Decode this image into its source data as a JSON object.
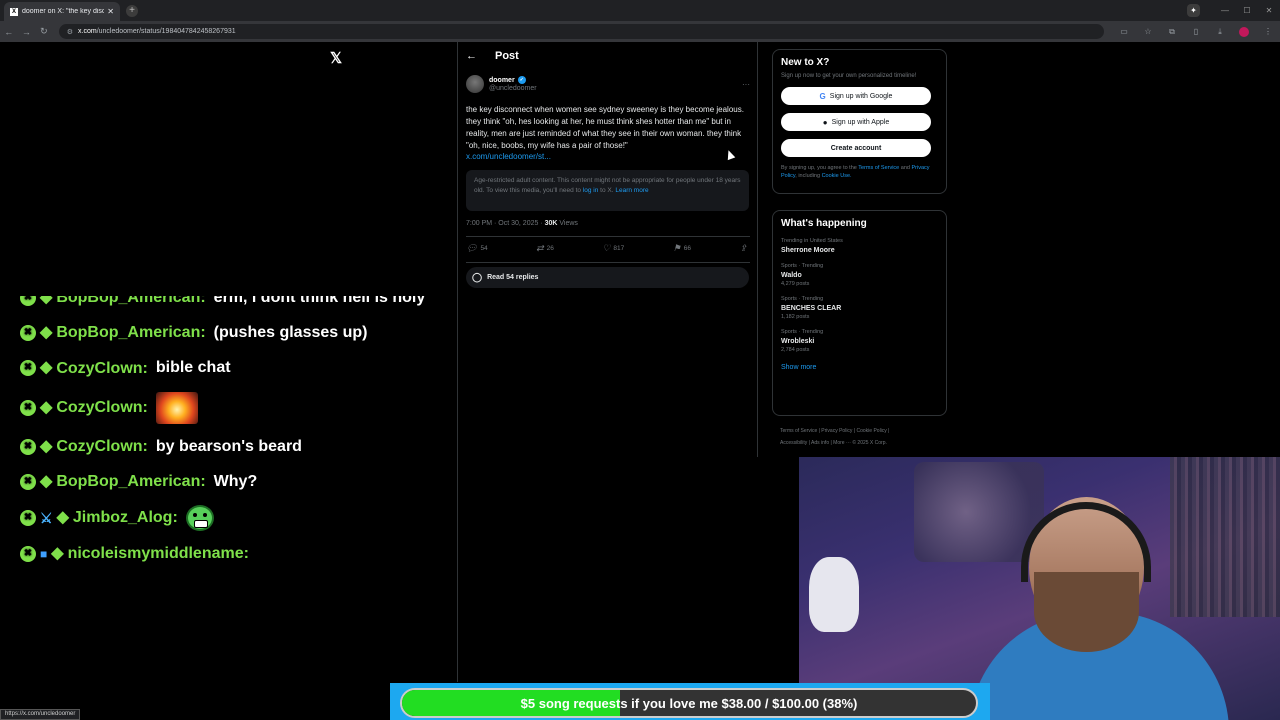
{
  "browser": {
    "tab_title": "doomer on X: \"the key disconnect",
    "url_host": "x.com",
    "url_path": "/uncledoomer/status/1984047842458267931",
    "status_url": "https://x.com/uncledoomer"
  },
  "post": {
    "header_title": "Post",
    "author_name": "doomer",
    "author_handle": "@uncledoomer",
    "text": "the key disconnect when women see sydney sweeney is they become jealous. they think \"oh, hes looking at her, he must think shes hotter than me\" but in reality, men are just reminded of what they see in their own woman. they think \"oh, nice, boobs, my wife has a pair of those!\"",
    "link": "x.com/uncledoomer/st...",
    "age_notice": "Age-restricted adult content. This content might not be appropriate for people under 18 years old. To view this media, you'll need to",
    "age_login": "log in",
    "age_mid": "to X.",
    "age_learn": "Learn more",
    "timestamp": "7:00 PM · Oct 30, 2025 · ",
    "views_count": "30K",
    "views_label": " Views",
    "replies": "54",
    "reposts": "26",
    "likes": "817",
    "bookmarks": "66",
    "read_replies": "Read 54 replies"
  },
  "signup": {
    "title": "New to X?",
    "subtitle": "Sign up now to get your own personalized timeline!",
    "google": "Sign up with Google",
    "apple": "Sign up with Apple",
    "create": "Create account",
    "legal_pre": "By signing up, you agree to the",
    "terms": "Terms of Service",
    "and": "and",
    "privacy": "Privacy Policy",
    "including": ", including",
    "cookie": "Cookie Use."
  },
  "happening": {
    "title": "What's happening",
    "trends": [
      {
        "context": "Trending in United States",
        "name": "Sherrone Moore",
        "count": ""
      },
      {
        "context": "Sports · Trending",
        "name": "Waldo",
        "count": "4,279 posts"
      },
      {
        "context": "Sports · Trending",
        "name": "BENCHES CLEAR",
        "count": "1,182 posts"
      },
      {
        "context": "Sports · Trending",
        "name": "Wrobleski",
        "count": "2,784 posts"
      }
    ],
    "show_more": "Show more"
  },
  "footer": {
    "line1": "Terms of Service  |  Privacy Policy  |  Cookie Policy  |",
    "line2": "Accessibility  |  Ads info  |  More ···  © 2025 X Corp."
  },
  "chat": {
    "messages": [
      {
        "user": "BopBop_American:",
        "text": "erm, i dont think hell is holy"
      },
      {
        "user": "BopBop_American:",
        "text": "(pushes glasses up)"
      },
      {
        "user": "CozyClown:",
        "text": "bible chat"
      },
      {
        "user": "CozyClown:",
        "text": ""
      },
      {
        "user": "CozyClown:",
        "text": "by bearson's beard"
      },
      {
        "user": "BopBop_American:",
        "text": "Why?"
      },
      {
        "user": "Jimboz_Alog:",
        "text": ""
      },
      {
        "user": "nicoleismymiddlename:",
        "text": ""
      }
    ]
  },
  "donation": {
    "text": "$5 song requests if you love me $38.00 / $100.00 (38%)",
    "progress": 0.38,
    "fill_color": "#22dd22"
  },
  "colors": {
    "accent": "#1d9bf0",
    "chat_user": "#7fe04a"
  }
}
